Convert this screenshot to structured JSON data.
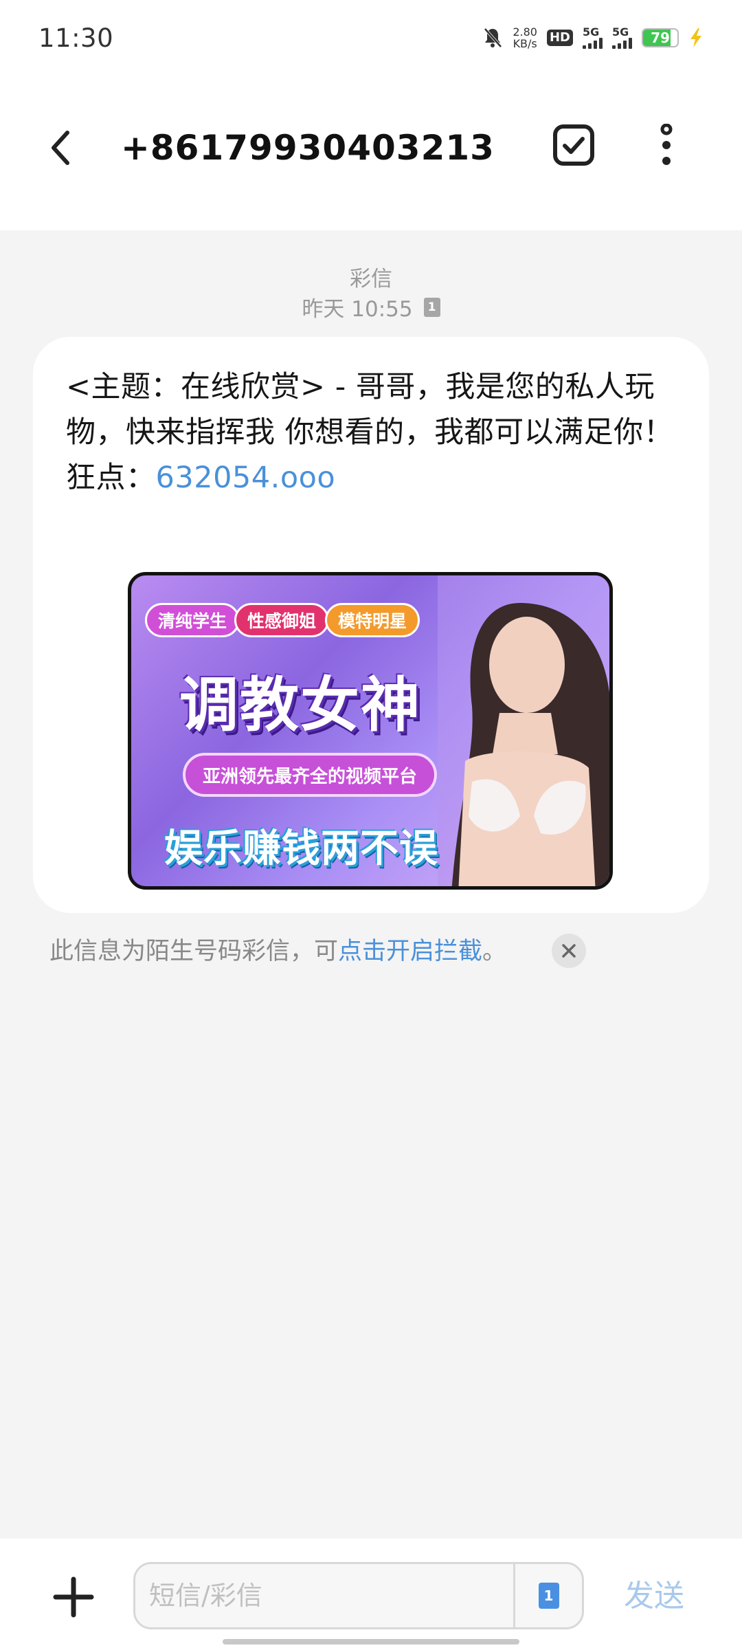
{
  "status_bar": {
    "time": "11:30",
    "net_speed_value": "2.80",
    "net_speed_unit": "KB/s",
    "hd_label": "HD",
    "signal_1_label": "5G",
    "signal_2_label": "5G",
    "battery_level": "79",
    "battery_fraction": 0.79,
    "icons": [
      "mute-bell-icon",
      "hd-voice-icon",
      "signal-icon",
      "signal-icon",
      "battery-icon",
      "charging-bolt-icon"
    ]
  },
  "header": {
    "title": "+8617993040321 3",
    "title_display": "+86179930403213",
    "icons": [
      "back-arrow-icon",
      "select-check-icon",
      "more-vertical-icon"
    ]
  },
  "message_meta": {
    "type_label": "彩信",
    "timestamp": "昨天 10:55",
    "sim_slot": "1"
  },
  "message": {
    "text": "<主题：在线欣赏> - 哥哥，我是您的私人玩物，快来指挥我   你想看的，我都可以满足你！狂点：",
    "link": "632054.ooo",
    "image": {
      "tags": [
        "清纯学生",
        "性感御姐",
        "模特明星"
      ],
      "headline": "调教女神",
      "subline": "亚洲领先最齐全的视频平台",
      "slogan": "娱乐赚钱两不误"
    }
  },
  "notice": {
    "text": "此信息为陌生号码彩信，可",
    "link": "点击开启拦截",
    "suffix": "。"
  },
  "composer": {
    "placeholder": "短信/彩信",
    "sim_slot": "1",
    "send_label": "发送",
    "colors": {
      "accent": "#4a90d9",
      "send_disabled": "#a9c9ec"
    }
  }
}
